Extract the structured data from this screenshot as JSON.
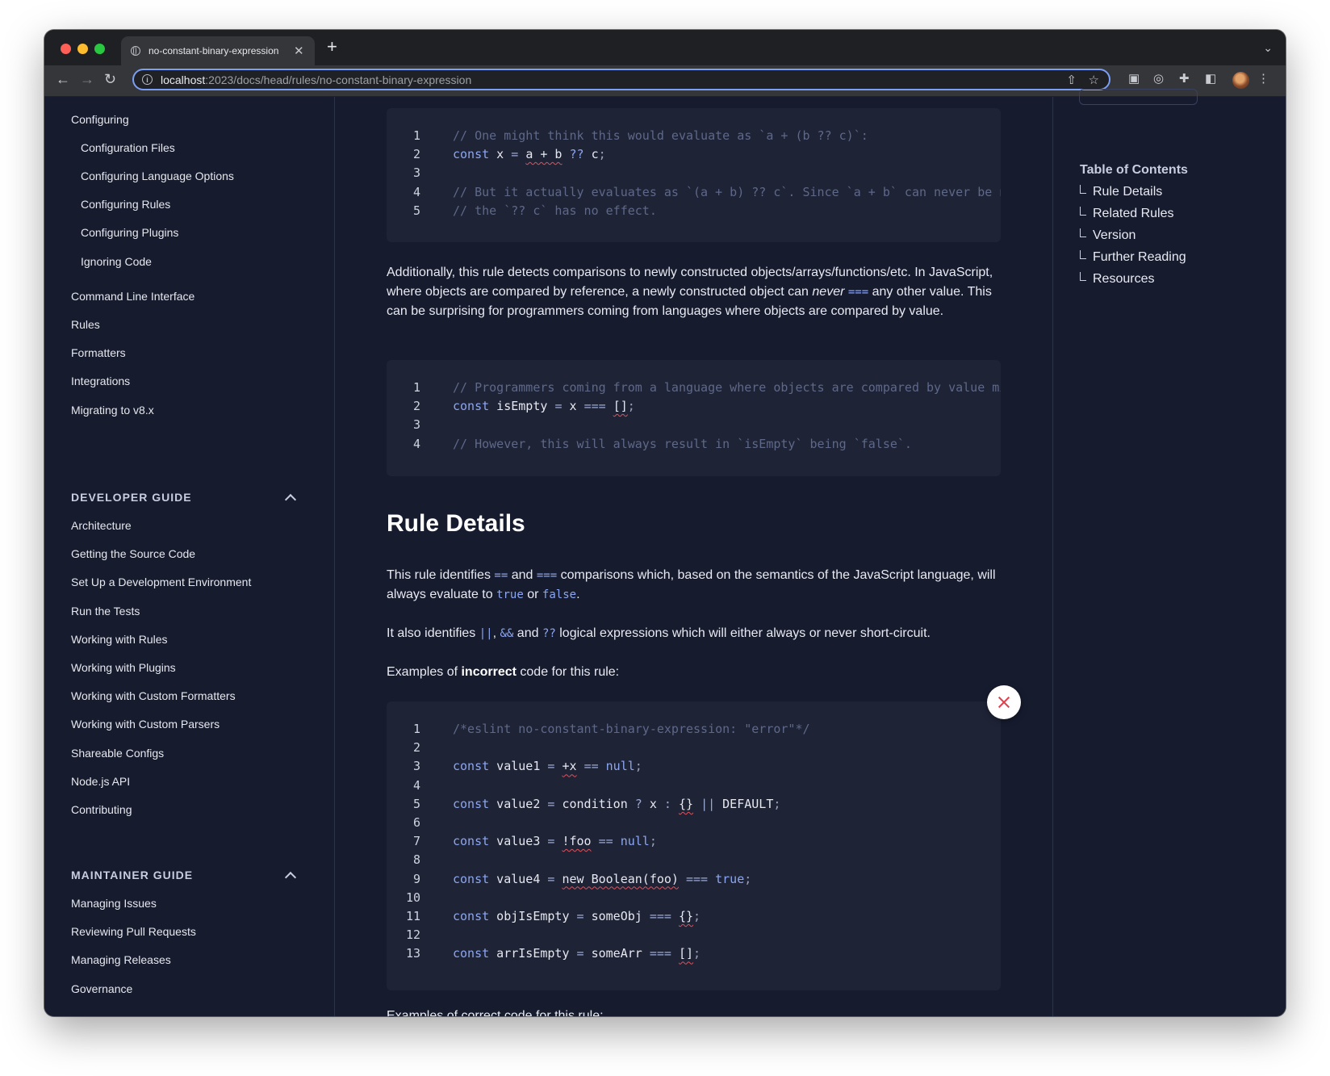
{
  "browser": {
    "tab_title": "no-constant-binary-expression",
    "url_host": "localhost",
    "url_path": ":2023/docs/head/rules/no-constant-binary-expression"
  },
  "sidebar": {
    "items": [
      {
        "label": "Configuring",
        "indent": 0
      },
      {
        "label": "Configuration Files",
        "indent": 1
      },
      {
        "label": "Configuring Language Options",
        "indent": 1
      },
      {
        "label": "Configuring Rules",
        "indent": 1
      },
      {
        "label": "Configuring Plugins",
        "indent": 1
      },
      {
        "label": "Ignoring Code",
        "indent": 1
      },
      {
        "label": "Command Line Interface",
        "indent": 0
      },
      {
        "label": "Rules",
        "indent": 0
      },
      {
        "label": "Formatters",
        "indent": 0
      },
      {
        "label": "Integrations",
        "indent": 0
      },
      {
        "label": "Migrating to v8.x",
        "indent": 0
      }
    ],
    "developer_guide": {
      "title": "DEVELOPER GUIDE",
      "items": [
        "Architecture",
        "Getting the Source Code",
        "Set Up a Development Environment",
        "Run the Tests",
        "Working with Rules",
        "Working with Plugins",
        "Working with Custom Formatters",
        "Working with Custom Parsers",
        "Shareable Configs",
        "Node.js API",
        "Contributing"
      ]
    },
    "maintainer_guide": {
      "title": "MAINTAINER GUIDE",
      "items": [
        "Managing Issues",
        "Reviewing Pull Requests",
        "Managing Releases",
        "Governance"
      ]
    }
  },
  "main": {
    "code1": [
      {
        "n": "1",
        "tokens": [
          [
            "c",
            "// One might think this would evaluate as `a + (b ?? c)`:"
          ]
        ]
      },
      {
        "n": "2",
        "tokens": [
          [
            "k",
            "const"
          ],
          [
            "v",
            " x "
          ],
          [
            "o",
            "="
          ],
          [
            "v",
            " "
          ],
          [
            "e",
            "a + b"
          ],
          [
            "v",
            " "
          ],
          [
            "k",
            "??"
          ],
          [
            "v",
            " c"
          ],
          [
            "p",
            ";"
          ]
        ]
      },
      {
        "n": "3",
        "tokens": []
      },
      {
        "n": "4",
        "tokens": [
          [
            "c",
            "// But it actually evaluates as `(a + b) ?? c`. Since `a + b` can never be null,"
          ]
        ]
      },
      {
        "n": "5",
        "tokens": [
          [
            "c",
            "// the `?? c` has no effect."
          ]
        ]
      }
    ],
    "para1": {
      "before": "Additionally, this rule detects comparisons to newly constructed objects/arrays/functions/etc. In JavaScript, where objects are compared by reference, a newly constructed object can ",
      "em": "never",
      "code": "===",
      "after": " any other value. This can be surprising for programmers coming from languages where objects are compared by value."
    },
    "code2": [
      {
        "n": "1",
        "tokens": [
          [
            "c",
            "// Programmers coming from a language where objects are compared by value might expect this to work:"
          ]
        ]
      },
      {
        "n": "2",
        "tokens": [
          [
            "k",
            "const"
          ],
          [
            "v",
            " isEmpty "
          ],
          [
            "o",
            "="
          ],
          [
            "v",
            " x "
          ],
          [
            "o",
            "==="
          ],
          [
            "v",
            " "
          ],
          [
            "e",
            "[]"
          ],
          [
            "p",
            ";"
          ]
        ]
      },
      {
        "n": "3",
        "tokens": []
      },
      {
        "n": "4",
        "tokens": [
          [
            "c",
            "// However, this will always result in `isEmpty` being `false`."
          ]
        ]
      }
    ],
    "rule_details_heading": "Rule Details",
    "para2": {
      "t1": "This rule identifies ",
      "c1": "==",
      "t2": " and ",
      "c2": "===",
      "t3": " comparisons which, based on the semantics of the JavaScript language, will always evaluate to ",
      "c3": "true",
      "t4": " or ",
      "c4": "false",
      "t5": "."
    },
    "para3": {
      "t1": "It also identifies ",
      "c1": "||",
      "t2": ", ",
      "c2": "&&",
      "t3": " and ",
      "c3": "??",
      "t4": " logical expressions which will either always or never short-circuit."
    },
    "para4": {
      "t1": "Examples of ",
      "b1": "incorrect",
      "t2": " code for this rule:"
    },
    "code3": [
      {
        "n": "1",
        "tokens": [
          [
            "c",
            "/*eslint no-constant-binary-expression: \"error\"*/"
          ]
        ]
      },
      {
        "n": "2",
        "tokens": []
      },
      {
        "n": "3",
        "tokens": [
          [
            "k",
            "const"
          ],
          [
            "v",
            " value1 "
          ],
          [
            "o",
            "="
          ],
          [
            "v",
            " "
          ],
          [
            "e",
            "+x"
          ],
          [
            "v",
            " "
          ],
          [
            "o",
            "=="
          ],
          [
            "v",
            " "
          ],
          [
            "k",
            "null"
          ],
          [
            "p",
            ";"
          ]
        ]
      },
      {
        "n": "4",
        "tokens": []
      },
      {
        "n": "5",
        "tokens": [
          [
            "k",
            "const"
          ],
          [
            "v",
            " value2 "
          ],
          [
            "o",
            "="
          ],
          [
            "v",
            " condition "
          ],
          [
            "o",
            "?"
          ],
          [
            "v",
            " x "
          ],
          [
            "o",
            ":"
          ],
          [
            "v",
            " "
          ],
          [
            "e",
            "{}"
          ],
          [
            "v",
            " "
          ],
          [
            "o",
            "||"
          ],
          [
            "v",
            " DEFAULT"
          ],
          [
            "p",
            ";"
          ]
        ]
      },
      {
        "n": "6",
        "tokens": []
      },
      {
        "n": "7",
        "tokens": [
          [
            "k",
            "const"
          ],
          [
            "v",
            " value3 "
          ],
          [
            "o",
            "="
          ],
          [
            "v",
            " "
          ],
          [
            "e",
            "!foo"
          ],
          [
            "v",
            " "
          ],
          [
            "o",
            "=="
          ],
          [
            "v",
            " "
          ],
          [
            "k",
            "null"
          ],
          [
            "p",
            ";"
          ]
        ]
      },
      {
        "n": "8",
        "tokens": []
      },
      {
        "n": "9",
        "tokens": [
          [
            "k",
            "const"
          ],
          [
            "v",
            " value4 "
          ],
          [
            "o",
            "="
          ],
          [
            "v",
            " "
          ],
          [
            "e",
            "new Boolean(foo)"
          ],
          [
            "v",
            " "
          ],
          [
            "o",
            "==="
          ],
          [
            "v",
            " "
          ],
          [
            "k",
            "true"
          ],
          [
            "p",
            ";"
          ]
        ]
      },
      {
        "n": "10",
        "tokens": []
      },
      {
        "n": "11",
        "tokens": [
          [
            "k",
            "const"
          ],
          [
            "v",
            " objIsEmpty "
          ],
          [
            "o",
            "="
          ],
          [
            "v",
            " someObj "
          ],
          [
            "o",
            "==="
          ],
          [
            "v",
            " "
          ],
          [
            "e",
            "{}"
          ],
          [
            "p",
            ";"
          ]
        ]
      },
      {
        "n": "12",
        "tokens": []
      },
      {
        "n": "13",
        "tokens": [
          [
            "k",
            "const"
          ],
          [
            "v",
            " arrIsEmpty "
          ],
          [
            "o",
            "="
          ],
          [
            "v",
            " someArr "
          ],
          [
            "o",
            "==="
          ],
          [
            "v",
            " "
          ],
          [
            "e",
            "[]"
          ],
          [
            "p",
            ";"
          ]
        ]
      }
    ],
    "para5_partial": "Examples of correct code for this rule:"
  },
  "toc": {
    "title": "Table of Contents",
    "items": [
      "Rule Details",
      "Related Rules",
      "Version",
      "Further Reading",
      "Resources"
    ]
  },
  "colors": {
    "page_bg": "#161b2e",
    "code_bg": "#1e2336",
    "keyword": "#8ca6ef",
    "comment": "#5e6889",
    "error_squiggle": "#e0525c"
  }
}
